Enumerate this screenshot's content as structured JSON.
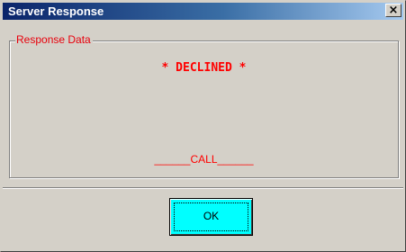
{
  "window": {
    "title": "Server Response",
    "close_icon": "close-icon",
    "close_glyph": "×"
  },
  "response_group": {
    "label": "Response Data",
    "status": "* DECLINED *",
    "message": "______CALL______"
  },
  "footer": {
    "ok_label": "OK"
  },
  "colors": {
    "title_bar": "#0a246a",
    "dialog_background": "#d4d0c8",
    "text_alert": "#ff0000",
    "ok_button": "#00ffff"
  }
}
